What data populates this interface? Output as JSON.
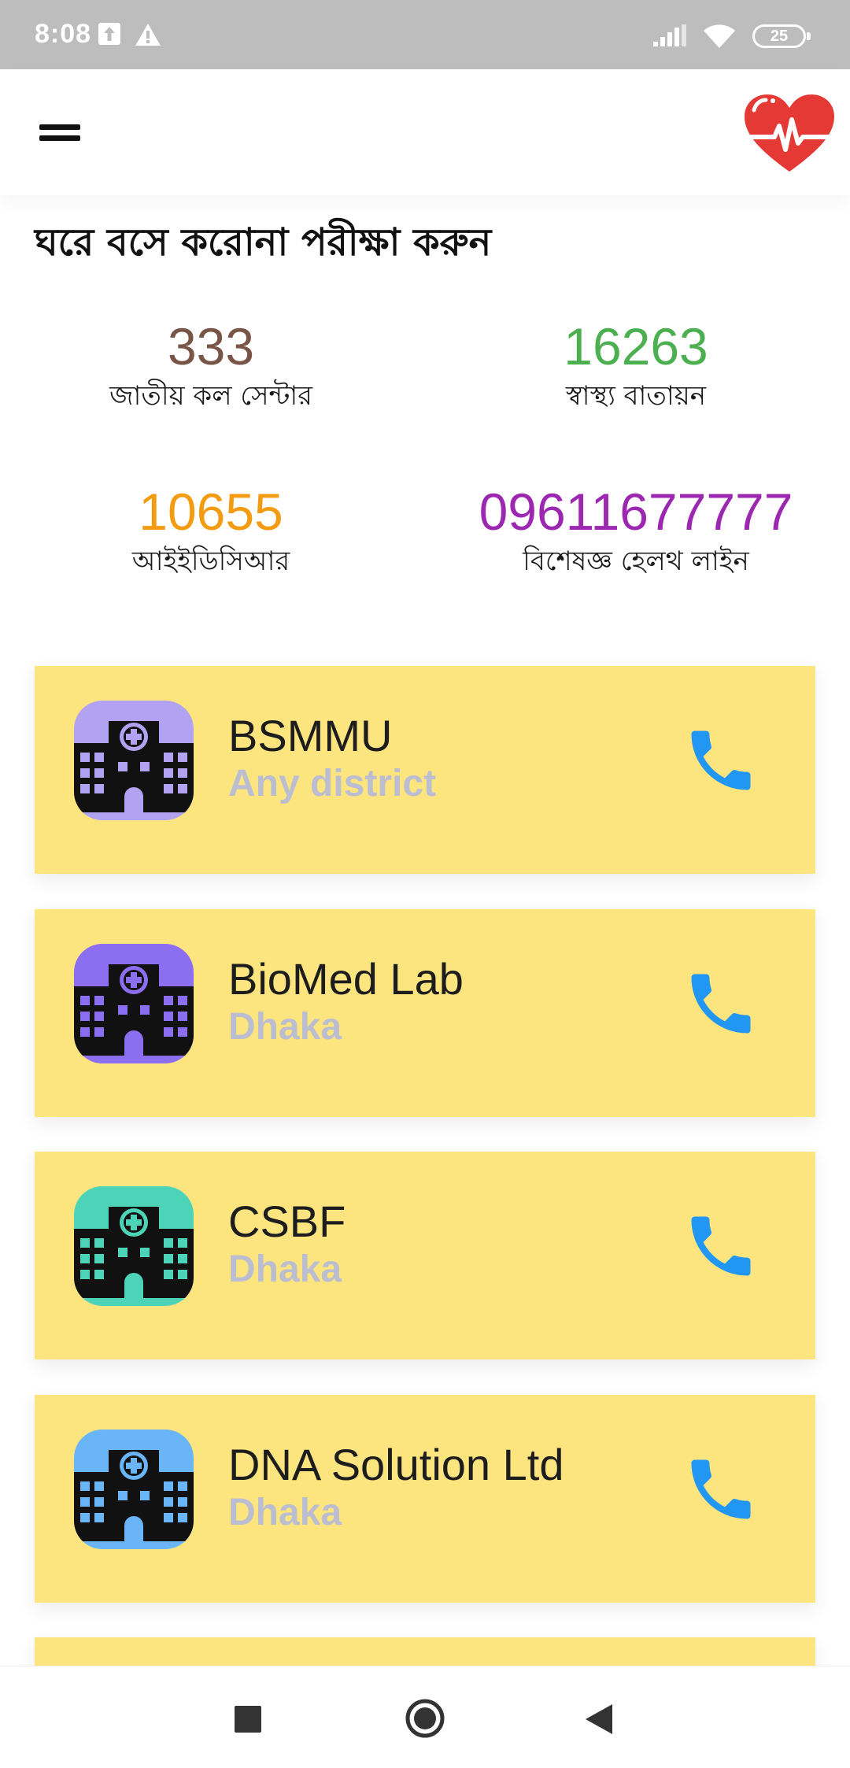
{
  "status_bar": {
    "time": "8:08",
    "battery": "25"
  },
  "app_bar": {
    "menu_icon": "hamburger-menu-icon",
    "logo_icon": "heart-pulse-logo"
  },
  "page": {
    "title": "ঘরে বসে করোনা পরীক্ষা করুন"
  },
  "hotlines": [
    {
      "number": "333",
      "label": "জাতীয় কল সেন্টার",
      "color": "#795548"
    },
    {
      "number": "16263",
      "label": "স্বাস্থ্য বাতায়ন",
      "color": "#4caf50"
    },
    {
      "number": "10655",
      "label": "আইইডিসিআর",
      "color": "#f39c12"
    },
    {
      "number": "09611677777",
      "label": "বিশেষজ্ঞ হেলথ লাইন",
      "color": "#9c27b0"
    }
  ],
  "labs": [
    {
      "name": "BSMMU",
      "district": "Any district",
      "icon_bg": "#b1a3f2"
    },
    {
      "name": "BioMed Lab",
      "district": "Dhaka",
      "icon_bg": "#8c6ff0"
    },
    {
      "name": "CSBF",
      "district": "Dhaka",
      "icon_bg": "#4dd4b8"
    },
    {
      "name": "DNA Solution Ltd",
      "district": "Dhaka",
      "icon_bg": "#6ab4f8"
    }
  ],
  "colors": {
    "card_bg": "#fce47f",
    "district_text": "#bbbdd0",
    "phone_icon": "#2196f3",
    "heart": "#e53935"
  }
}
